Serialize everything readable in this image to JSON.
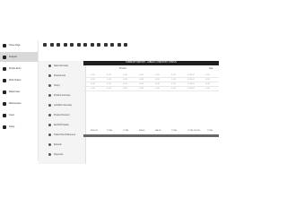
{
  "sidebar": {
    "items": [
      {
        "label": "Home Page",
        "icon": "home-icon"
      },
      {
        "label": "Analysis",
        "icon": "chart-icon"
      },
      {
        "label": "Simple Entry",
        "icon": "grid-icon"
      },
      {
        "label": "Work Orders",
        "icon": "wrench-icon"
      },
      {
        "label": "Warehouse",
        "icon": "box-icon"
      },
      {
        "label": "Maintenance",
        "icon": "gear-icon"
      },
      {
        "label": "Users",
        "icon": "user-icon"
      },
      {
        "label": "Setup",
        "icon": "settings-icon"
      }
    ]
  },
  "submenu": {
    "items": [
      {
        "label": "Sales Summary",
        "icon": "chart-icon"
      },
      {
        "label": "Departments",
        "icon": "folder-icon"
      },
      {
        "label": "Hourly",
        "icon": "clock-icon"
      },
      {
        "label": "Product Summary",
        "icon": "tag-icon"
      },
      {
        "label": "Condition Summary",
        "icon": "list-icon"
      },
      {
        "label": "Product Discount",
        "icon": "percent-icon"
      },
      {
        "label": "Discount Details",
        "icon": "doc-icon"
      },
      {
        "label": "Ticket Price Differences",
        "icon": "ticket-icon"
      },
      {
        "label": "Refunds",
        "icon": "refund-icon"
      },
      {
        "label": "Payments",
        "icon": "card-icon"
      }
    ]
  },
  "toolbar": {
    "icons": [
      "grid-icon",
      "print-icon",
      "save-icon",
      "copy-icon",
      "edit-icon",
      "chart-icon",
      "list-icon",
      "calendar-icon",
      "help-icon",
      "filter-icon",
      "export-icon",
      "pdf-icon",
      "mail-icon"
    ]
  },
  "table": {
    "title": "SUMMARY REPORT - LABELS / CHECKOUT STATUS",
    "subheaders": [
      "",
      "Product",
      "",
      "Sale"
    ],
    "rows": [
      [
        "#,###",
        "#,###",
        "#,###",
        "#,###",
        "#,###",
        "#,###",
        "#,###.##",
        "#,###"
      ],
      [
        "#,###",
        "#,###",
        "#,###",
        "#,###",
        "#,###",
        "#,###",
        "#,###.##",
        "#,###"
      ],
      [
        "#,###",
        "#,###",
        "#,###",
        "#,###",
        "#,###",
        "#,###",
        "#,###.##",
        "#,###"
      ],
      [
        "#,###",
        "#,###",
        "#,###",
        "#,###",
        "#,###",
        "#,###",
        "#,###.##",
        "#,###"
      ]
    ],
    "totals": [
      "REGION",
      "TOTAL",
      "TOTAL",
      "SALES",
      "SALES",
      "TOTAL",
      "TOTAL GROSS",
      "TOTAL"
    ],
    "footer_note": "## ##"
  }
}
